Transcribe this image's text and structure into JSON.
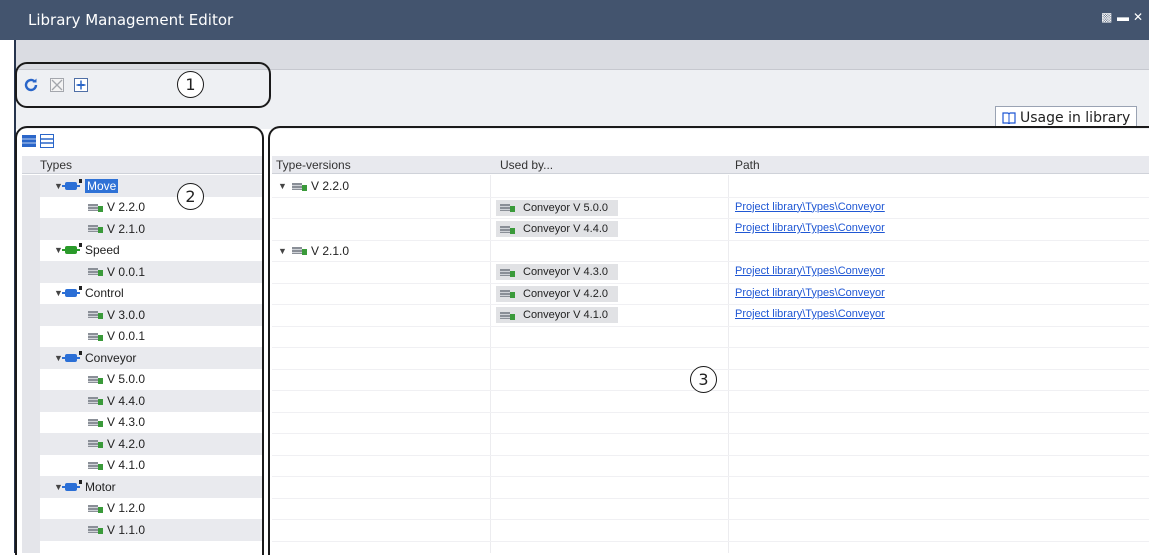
{
  "window": {
    "title": "Library Management Editor"
  },
  "toolbar": {
    "buttons": [
      "refresh-icon",
      "delete-icon",
      "add-icon"
    ]
  },
  "usage_tab": {
    "label": "Usage in library"
  },
  "callouts": [
    "1",
    "2",
    "3"
  ],
  "types_panel": {
    "header": "Types",
    "items": [
      {
        "kind": "type",
        "label": "Move",
        "color": "#2b6fd6",
        "selected": true,
        "expanded": true
      },
      {
        "kind": "version",
        "label": "V 2.2.0"
      },
      {
        "kind": "version",
        "label": "V 2.1.0"
      },
      {
        "kind": "type",
        "label": "Speed",
        "color": "#2a9a2a",
        "expanded": true
      },
      {
        "kind": "version",
        "label": "V 0.0.1"
      },
      {
        "kind": "type",
        "label": "Control",
        "color": "#2b6fd6",
        "expanded": true
      },
      {
        "kind": "version",
        "label": "V 3.0.0"
      },
      {
        "kind": "version",
        "label": "V 0.0.1"
      },
      {
        "kind": "type",
        "label": "Conveyor",
        "color": "#2b6fd6",
        "expanded": true
      },
      {
        "kind": "version",
        "label": "V 5.0.0"
      },
      {
        "kind": "version",
        "label": "V 4.4.0"
      },
      {
        "kind": "version",
        "label": "V 4.3.0"
      },
      {
        "kind": "version",
        "label": "V 4.2.0"
      },
      {
        "kind": "version",
        "label": "V 4.1.0"
      },
      {
        "kind": "type",
        "label": "Motor",
        "color": "#2b6fd6",
        "expanded": true
      },
      {
        "kind": "version",
        "label": "V 1.2.0"
      },
      {
        "kind": "version",
        "label": "V 1.1.0"
      }
    ]
  },
  "usage_table": {
    "headers": [
      "Type-versions",
      "Used by...",
      "Path"
    ],
    "rows": [
      {
        "version": "V 2.2.0",
        "used_by": "",
        "path": ""
      },
      {
        "version": "",
        "used_by": "Conveyor V 5.0.0",
        "path": "Project library\\Types\\Conveyor"
      },
      {
        "version": "",
        "used_by": "Conveyor V 4.4.0",
        "path": "Project library\\Types\\Conveyor"
      },
      {
        "version": "V 2.1.0",
        "used_by": "",
        "path": ""
      },
      {
        "version": "",
        "used_by": "Conveyor V 4.3.0",
        "path": "Project library\\Types\\Conveyor"
      },
      {
        "version": "",
        "used_by": "Conveyor V 4.2.0",
        "path": "Project library\\Types\\Conveyor"
      },
      {
        "version": "",
        "used_by": "Conveyor V 4.1.0",
        "path": "Project library\\Types\\Conveyor"
      }
    ]
  },
  "colors": {
    "titlebar": "#43546e",
    "selection": "#2f72d6",
    "link": "#1f57d4"
  }
}
